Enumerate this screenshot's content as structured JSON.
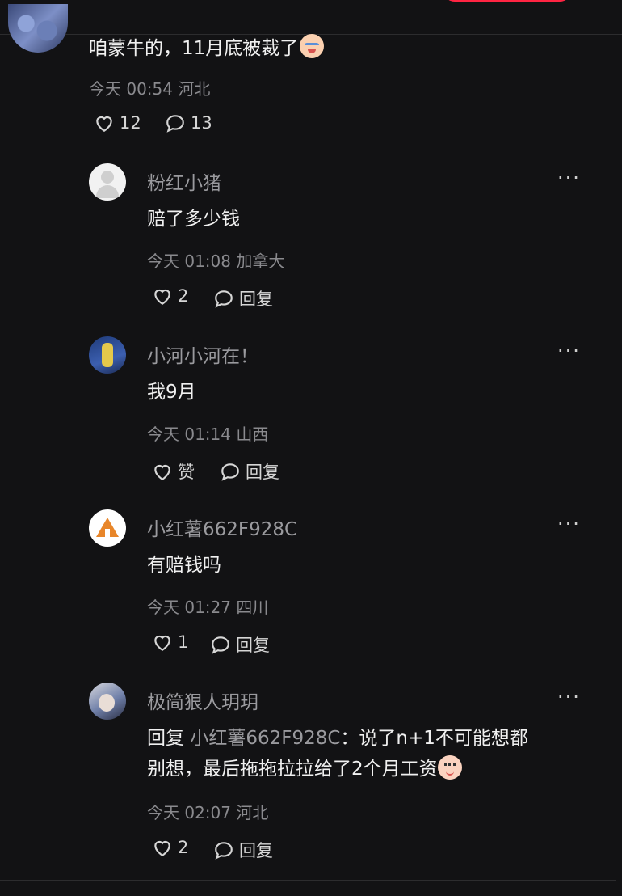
{
  "main_comment": {
    "text": "咱蒙牛的，11月底被裁了",
    "emoji": "crying-face-emoji",
    "time": "今天 00:54",
    "location": "河北",
    "likes": "12",
    "replies": "13"
  },
  "replies": [
    {
      "name": "粉红小猪",
      "avatar": "default-avatar",
      "text": "赔了多少钱",
      "time": "今天 01:08",
      "location": "加拿大",
      "likes": "2",
      "reply_label": "回复"
    },
    {
      "name": "小河小河在！",
      "avatar": "user-avatar",
      "text": "我9月",
      "time": "今天 01:14",
      "location": "山西",
      "likes": "赞",
      "reply_label": "回复"
    },
    {
      "name": "小红薯662F928C",
      "avatar": "tent-avatar",
      "text": "有赔钱吗",
      "time": "今天 01:27",
      "location": "四川",
      "likes": "1",
      "reply_label": "回复"
    },
    {
      "name": "极简狠人玥玥",
      "avatar": "user-avatar",
      "reply_prefix": "回复",
      "reply_to": "小红薯662F928C",
      "separator": "：",
      "text_line1": "说了n+1不可能想都",
      "text_line2": "别想，最后拖拖拉拉给了2个月工资",
      "emoji": "smiling-face-emoji",
      "time": "今天 02:07",
      "location": "河北",
      "likes": "2",
      "reply_label": "回复"
    }
  ],
  "more_label": "···",
  "colors": {
    "background": "#121214",
    "text_primary": "#f0f0f0",
    "text_secondary": "#8a8a8e",
    "accent": "#ff2442"
  }
}
